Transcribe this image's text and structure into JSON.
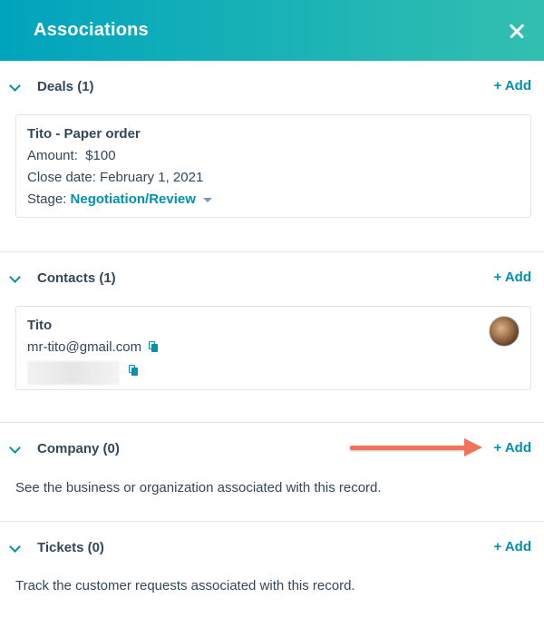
{
  "header": {
    "title": "Associations",
    "close_icon": "close-icon"
  },
  "deals": {
    "title": "Deals (1)",
    "add_label": "+ Add",
    "card": {
      "name": "Tito - Paper order",
      "amount_label": "Amount:",
      "amount_value": "$100",
      "close_date": "Close date: February 1, 2021",
      "stage_label": "Stage:",
      "stage_value": "Negotiation/Review"
    }
  },
  "contacts": {
    "title": "Contacts (1)",
    "add_label": "+ Add",
    "card": {
      "name": "Tito",
      "email": "mr-tito@gmail.com"
    }
  },
  "company": {
    "title": "Company (0)",
    "add_label": "+ Add",
    "description": "See the business or organization associated with this record."
  },
  "tickets": {
    "title": "Tickets (0)",
    "add_label": "+ Add",
    "description": "Track the customer requests associated with this record."
  },
  "colors": {
    "header_start": "#00a4bd",
    "header_end": "#33bfb0",
    "link": "#0091ae",
    "text": "#33475b",
    "annotation_arrow": "#f0745b"
  }
}
